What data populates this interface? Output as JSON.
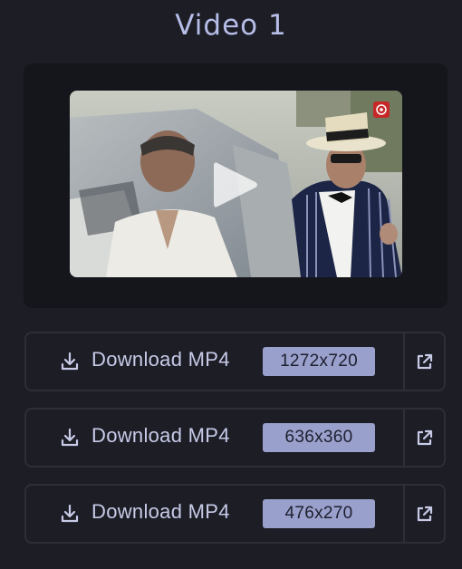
{
  "title": "Video 1",
  "icons": {
    "play": "play-icon",
    "download": "download-icon",
    "external": "external-link-icon",
    "channel_logo": "channel-logo-icon"
  },
  "colors": {
    "background": "#1c1d25",
    "card": "#15161c",
    "title": "#b7bde8",
    "badge": "#9aa0cc",
    "border": "#2d2e38"
  },
  "downloads": [
    {
      "label": "Download MP4",
      "resolution": "1272x720"
    },
    {
      "label": "Download MP4",
      "resolution": "636x360"
    },
    {
      "label": "Download MP4",
      "resolution": "476x270"
    }
  ]
}
